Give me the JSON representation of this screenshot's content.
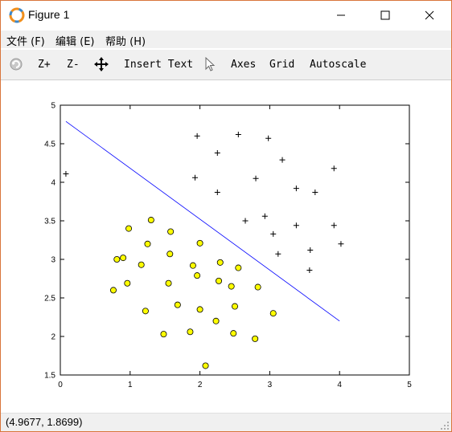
{
  "window": {
    "title": "Figure 1",
    "minimize_icon": "minimize-icon",
    "maximize_icon": "maximize-icon",
    "close_icon": "close-icon"
  },
  "menu": {
    "items": [
      {
        "label": "文件 (F)"
      },
      {
        "label": "编辑 (E)"
      },
      {
        "label": "帮助 (H)"
      }
    ]
  },
  "toolbar": {
    "rotate_icon": "rotate-icon",
    "zoom_in_label": "Z+",
    "zoom_out_label": "Z-",
    "pan_icon": "pan-move-icon",
    "insert_text_label": "Insert Text",
    "select_icon": "pointer-icon",
    "axes_label": "Axes",
    "grid_label": "Grid",
    "autoscale_label": "Autoscale"
  },
  "status": {
    "coordinates": "(4.9677, 1.8699)"
  },
  "colors": {
    "positive_marker": "#000000",
    "negative_fill": "#ffff00",
    "boundary": "#0000ff",
    "window_border": "#d9763c"
  },
  "chart_data": {
    "type": "scatter",
    "title": "",
    "xlabel": "",
    "ylabel": "",
    "xlim": [
      0,
      5
    ],
    "ylim": [
      1.5,
      5
    ],
    "grid": false,
    "x_ticks": [
      "0",
      "1",
      "2",
      "3",
      "4",
      "5"
    ],
    "y_ticks": [
      "1.5",
      "2",
      "2.5",
      "3",
      "3.5",
      "4",
      "4.5",
      "5"
    ],
    "series": [
      {
        "marker": "plus",
        "points": [
          [
            0.08,
            4.11
          ],
          [
            1.96,
            4.6
          ],
          [
            2.25,
            4.38
          ],
          [
            2.55,
            4.62
          ],
          [
            2.98,
            4.57
          ],
          [
            3.18,
            4.29
          ],
          [
            3.92,
            4.18
          ],
          [
            1.93,
            4.06
          ],
          [
            2.25,
            3.87
          ],
          [
            2.8,
            4.05
          ],
          [
            3.38,
            3.92
          ],
          [
            3.65,
            3.87
          ],
          [
            2.65,
            3.5
          ],
          [
            2.93,
            3.56
          ],
          [
            3.38,
            3.44
          ],
          [
            3.92,
            3.44
          ],
          [
            3.05,
            3.33
          ],
          [
            4.02,
            3.2
          ],
          [
            3.12,
            3.07
          ],
          [
            3.58,
            3.12
          ],
          [
            3.57,
            2.86
          ]
        ]
      },
      {
        "marker": "circle",
        "points": [
          [
            0.98,
            3.4
          ],
          [
            1.3,
            3.51
          ],
          [
            1.58,
            3.36
          ],
          [
            2.0,
            3.21
          ],
          [
            1.25,
            3.2
          ],
          [
            0.81,
            3.0
          ],
          [
            0.9,
            3.02
          ],
          [
            1.16,
            2.93
          ],
          [
            1.57,
            3.07
          ],
          [
            1.9,
            2.92
          ],
          [
            2.29,
            2.96
          ],
          [
            2.55,
            2.89
          ],
          [
            1.96,
            2.79
          ],
          [
            0.96,
            2.69
          ],
          [
            1.55,
            2.69
          ],
          [
            2.27,
            2.72
          ],
          [
            2.45,
            2.65
          ],
          [
            2.83,
            2.64
          ],
          [
            0.76,
            2.6
          ],
          [
            1.68,
            2.41
          ],
          [
            2.0,
            2.35
          ],
          [
            2.5,
            2.39
          ],
          [
            1.22,
            2.33
          ],
          [
            3.05,
            2.3
          ],
          [
            2.23,
            2.2
          ],
          [
            1.48,
            2.03
          ],
          [
            1.86,
            2.06
          ],
          [
            2.48,
            2.04
          ],
          [
            2.79,
            1.97
          ],
          [
            2.08,
            1.62
          ]
        ]
      },
      {
        "type": "line",
        "points": [
          [
            0.08,
            4.79
          ],
          [
            4.0,
            2.2
          ]
        ]
      }
    ]
  }
}
